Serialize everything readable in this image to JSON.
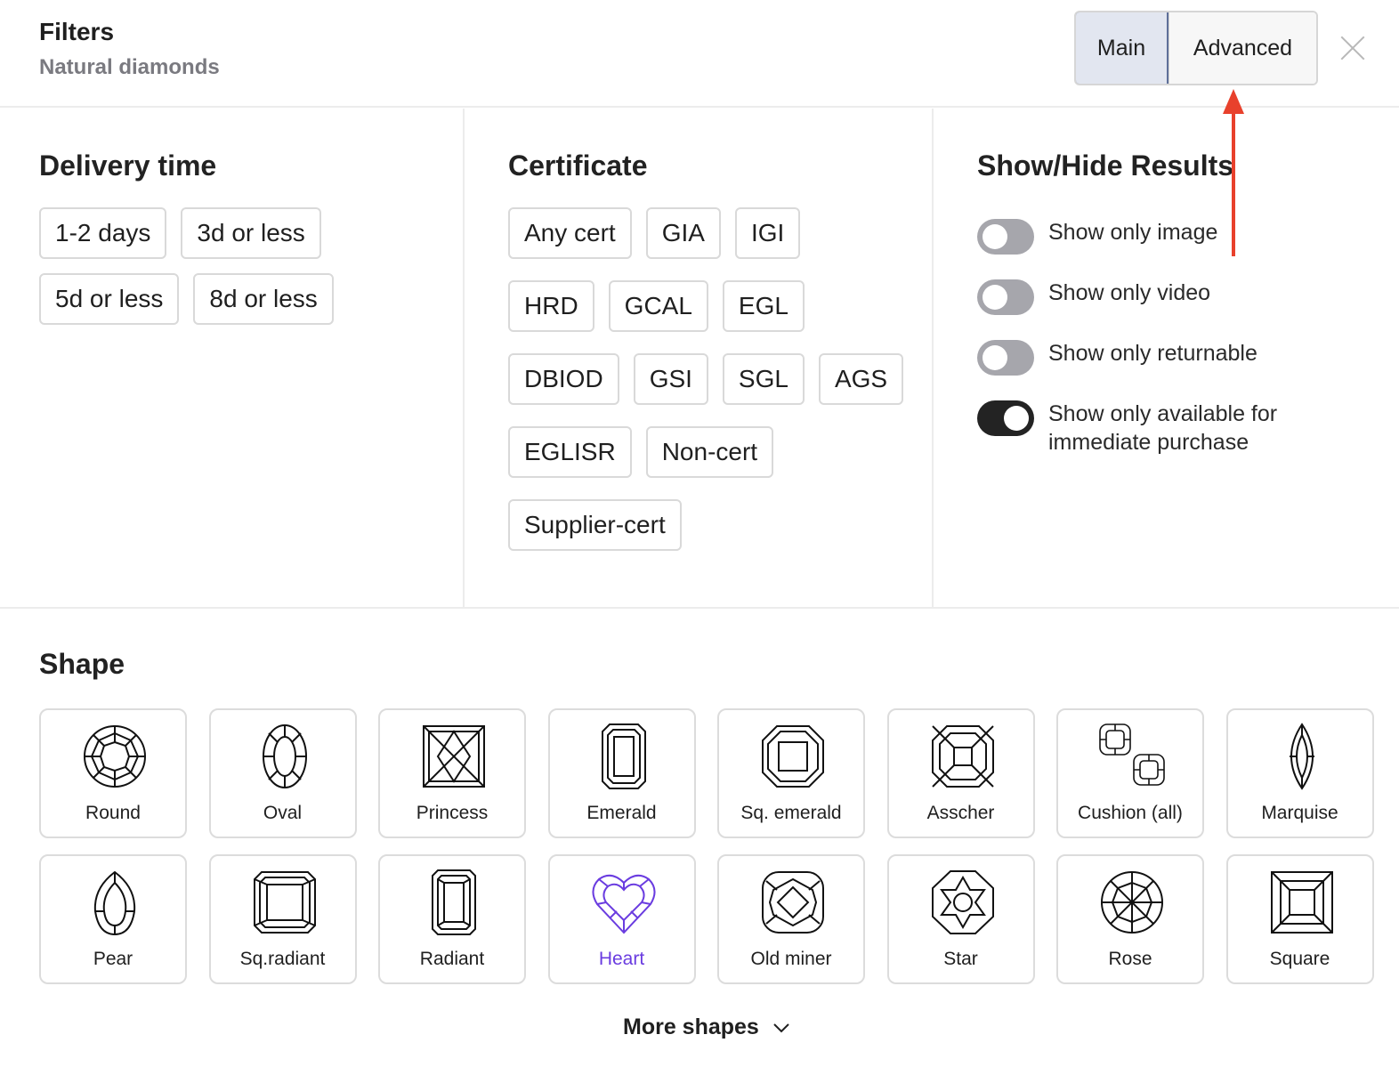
{
  "header": {
    "title": "Filters",
    "subtitle": "Natural diamonds",
    "tabs": [
      {
        "label": "Main",
        "selected": true
      },
      {
        "label": "Advanced",
        "selected": false
      }
    ],
    "close_icon": "close-icon"
  },
  "delivery": {
    "title": "Delivery time",
    "options": [
      "1-2 days",
      "3d or less",
      "5d or less",
      "8d or less"
    ]
  },
  "certificate": {
    "title": "Certificate",
    "rows": [
      [
        "Any cert",
        "GIA",
        "IGI"
      ],
      [
        "HRD",
        "GCAL",
        "EGL"
      ],
      [
        "DBIOD",
        "GSI",
        "SGL",
        "AGS"
      ],
      [
        "EGLISR",
        "Non-cert"
      ],
      [
        "Supplier-cert"
      ]
    ]
  },
  "results": {
    "title": "Show/Hide Results",
    "toggles": [
      {
        "label": "Show only image",
        "on": false
      },
      {
        "label": "Show only video",
        "on": false
      },
      {
        "label": "Show only returnable",
        "on": false
      },
      {
        "label": "Show only available for immediate purchase",
        "on": true
      }
    ]
  },
  "shape": {
    "title": "Shape",
    "items": [
      {
        "label": "Round",
        "icon": "round-diamond-icon"
      },
      {
        "label": "Oval",
        "icon": "oval-diamond-icon"
      },
      {
        "label": "Princess",
        "icon": "princess-diamond-icon"
      },
      {
        "label": "Emerald",
        "icon": "emerald-diamond-icon"
      },
      {
        "label": "Sq. emerald",
        "icon": "square-emerald-diamond-icon"
      },
      {
        "label": "Asscher",
        "icon": "asscher-diamond-icon"
      },
      {
        "label": "Cushion (all)",
        "icon": "cushion-diamond-icon"
      },
      {
        "label": "Marquise",
        "icon": "marquise-diamond-icon"
      },
      {
        "label": "Pear",
        "icon": "pear-diamond-icon"
      },
      {
        "label": "Sq.radiant",
        "icon": "square-radiant-diamond-icon"
      },
      {
        "label": "Radiant",
        "icon": "radiant-diamond-icon"
      },
      {
        "label": "Heart",
        "icon": "heart-diamond-icon",
        "selected": true
      },
      {
        "label": "Old miner",
        "icon": "old-miner-diamond-icon"
      },
      {
        "label": "Star",
        "icon": "star-diamond-icon"
      },
      {
        "label": "Rose",
        "icon": "rose-diamond-icon"
      },
      {
        "label": "Square",
        "icon": "square-diamond-icon"
      }
    ],
    "more_label": "More shapes"
  },
  "colors": {
    "selected_shape": "#6a3ce0",
    "annotation_arrow": "#e8412c",
    "main_tab_bg": "#e2e6f0",
    "toggle_on": "#232323",
    "toggle_off": "#a6a6ac"
  }
}
